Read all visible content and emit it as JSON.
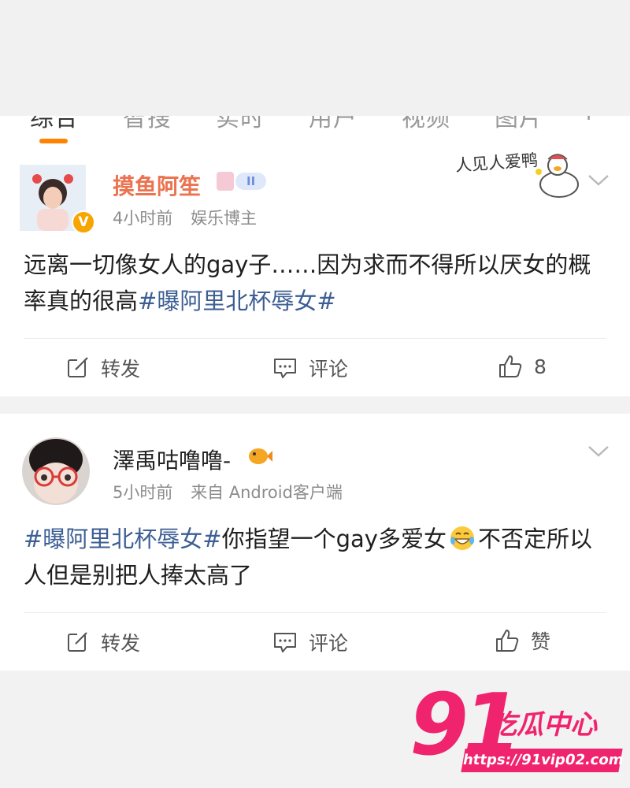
{
  "tabs": [
    "综合",
    "智搜",
    "实时",
    "用户",
    "视频",
    "图片",
    "+"
  ],
  "posts": [
    {
      "username": "摸鱼阿笙",
      "level_badge": "II",
      "time": "4小时前",
      "source": "娱乐博主",
      "verified_mark": "V",
      "sticker_text": "人见人爱鸭",
      "text_parts": [
        "远离一切像女人的gay子……因为求而不得所以厌女的概率真的很高",
        "#曝阿里北杯辱女#"
      ],
      "actions": {
        "repost": "转发",
        "comment": "评论",
        "like": "8"
      },
      "username_color": "#eb7350"
    },
    {
      "username": "澤禹咕噜噜-",
      "time": "5小时前",
      "source": "来自 Android客户端",
      "text_parts": [
        "#曝阿里北杯辱女#",
        "你指望一个gay多爱女",
        "不否定所以人但是别把人捧太高了"
      ],
      "actions": {
        "repost": "转发",
        "comment": "评论",
        "like": "赞"
      },
      "username_color": "#222222"
    }
  ],
  "watermark": {
    "number": "91",
    "title": "吃瓜中心",
    "url": "https://91vip02.com"
  },
  "colors": {
    "accent": "#ff8200",
    "hashtag": "#3c5e94",
    "watermark": "#f0246e"
  }
}
